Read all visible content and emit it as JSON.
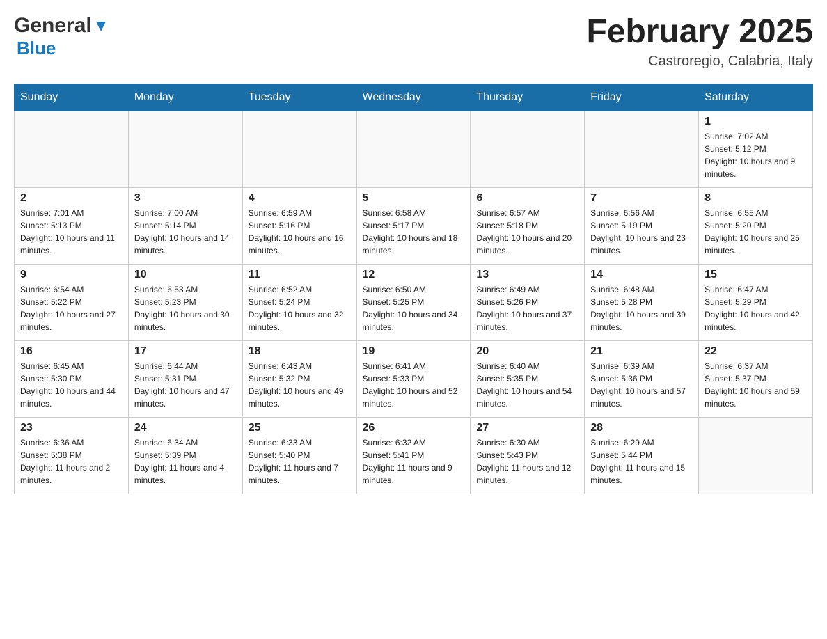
{
  "header": {
    "logo": {
      "general": "General",
      "blue": "Blue"
    },
    "title": "February 2025",
    "subtitle": "Castroregio, Calabria, Italy"
  },
  "days_of_week": [
    "Sunday",
    "Monday",
    "Tuesday",
    "Wednesday",
    "Thursday",
    "Friday",
    "Saturday"
  ],
  "weeks": [
    [
      {
        "day": null,
        "info": null
      },
      {
        "day": null,
        "info": null
      },
      {
        "day": null,
        "info": null
      },
      {
        "day": null,
        "info": null
      },
      {
        "day": null,
        "info": null
      },
      {
        "day": null,
        "info": null
      },
      {
        "day": "1",
        "info": "Sunrise: 7:02 AM\nSunset: 5:12 PM\nDaylight: 10 hours and 9 minutes."
      }
    ],
    [
      {
        "day": "2",
        "info": "Sunrise: 7:01 AM\nSunset: 5:13 PM\nDaylight: 10 hours and 11 minutes."
      },
      {
        "day": "3",
        "info": "Sunrise: 7:00 AM\nSunset: 5:14 PM\nDaylight: 10 hours and 14 minutes."
      },
      {
        "day": "4",
        "info": "Sunrise: 6:59 AM\nSunset: 5:16 PM\nDaylight: 10 hours and 16 minutes."
      },
      {
        "day": "5",
        "info": "Sunrise: 6:58 AM\nSunset: 5:17 PM\nDaylight: 10 hours and 18 minutes."
      },
      {
        "day": "6",
        "info": "Sunrise: 6:57 AM\nSunset: 5:18 PM\nDaylight: 10 hours and 20 minutes."
      },
      {
        "day": "7",
        "info": "Sunrise: 6:56 AM\nSunset: 5:19 PM\nDaylight: 10 hours and 23 minutes."
      },
      {
        "day": "8",
        "info": "Sunrise: 6:55 AM\nSunset: 5:20 PM\nDaylight: 10 hours and 25 minutes."
      }
    ],
    [
      {
        "day": "9",
        "info": "Sunrise: 6:54 AM\nSunset: 5:22 PM\nDaylight: 10 hours and 27 minutes."
      },
      {
        "day": "10",
        "info": "Sunrise: 6:53 AM\nSunset: 5:23 PM\nDaylight: 10 hours and 30 minutes."
      },
      {
        "day": "11",
        "info": "Sunrise: 6:52 AM\nSunset: 5:24 PM\nDaylight: 10 hours and 32 minutes."
      },
      {
        "day": "12",
        "info": "Sunrise: 6:50 AM\nSunset: 5:25 PM\nDaylight: 10 hours and 34 minutes."
      },
      {
        "day": "13",
        "info": "Sunrise: 6:49 AM\nSunset: 5:26 PM\nDaylight: 10 hours and 37 minutes."
      },
      {
        "day": "14",
        "info": "Sunrise: 6:48 AM\nSunset: 5:28 PM\nDaylight: 10 hours and 39 minutes."
      },
      {
        "day": "15",
        "info": "Sunrise: 6:47 AM\nSunset: 5:29 PM\nDaylight: 10 hours and 42 minutes."
      }
    ],
    [
      {
        "day": "16",
        "info": "Sunrise: 6:45 AM\nSunset: 5:30 PM\nDaylight: 10 hours and 44 minutes."
      },
      {
        "day": "17",
        "info": "Sunrise: 6:44 AM\nSunset: 5:31 PM\nDaylight: 10 hours and 47 minutes."
      },
      {
        "day": "18",
        "info": "Sunrise: 6:43 AM\nSunset: 5:32 PM\nDaylight: 10 hours and 49 minutes."
      },
      {
        "day": "19",
        "info": "Sunrise: 6:41 AM\nSunset: 5:33 PM\nDaylight: 10 hours and 52 minutes."
      },
      {
        "day": "20",
        "info": "Sunrise: 6:40 AM\nSunset: 5:35 PM\nDaylight: 10 hours and 54 minutes."
      },
      {
        "day": "21",
        "info": "Sunrise: 6:39 AM\nSunset: 5:36 PM\nDaylight: 10 hours and 57 minutes."
      },
      {
        "day": "22",
        "info": "Sunrise: 6:37 AM\nSunset: 5:37 PM\nDaylight: 10 hours and 59 minutes."
      }
    ],
    [
      {
        "day": "23",
        "info": "Sunrise: 6:36 AM\nSunset: 5:38 PM\nDaylight: 11 hours and 2 minutes."
      },
      {
        "day": "24",
        "info": "Sunrise: 6:34 AM\nSunset: 5:39 PM\nDaylight: 11 hours and 4 minutes."
      },
      {
        "day": "25",
        "info": "Sunrise: 6:33 AM\nSunset: 5:40 PM\nDaylight: 11 hours and 7 minutes."
      },
      {
        "day": "26",
        "info": "Sunrise: 6:32 AM\nSunset: 5:41 PM\nDaylight: 11 hours and 9 minutes."
      },
      {
        "day": "27",
        "info": "Sunrise: 6:30 AM\nSunset: 5:43 PM\nDaylight: 11 hours and 12 minutes."
      },
      {
        "day": "28",
        "info": "Sunrise: 6:29 AM\nSunset: 5:44 PM\nDaylight: 11 hours and 15 minutes."
      },
      {
        "day": null,
        "info": null
      }
    ]
  ],
  "colors": {
    "header_bg": "#1a6ea8",
    "header_text": "#ffffff",
    "accent_blue": "#1a7abf"
  }
}
